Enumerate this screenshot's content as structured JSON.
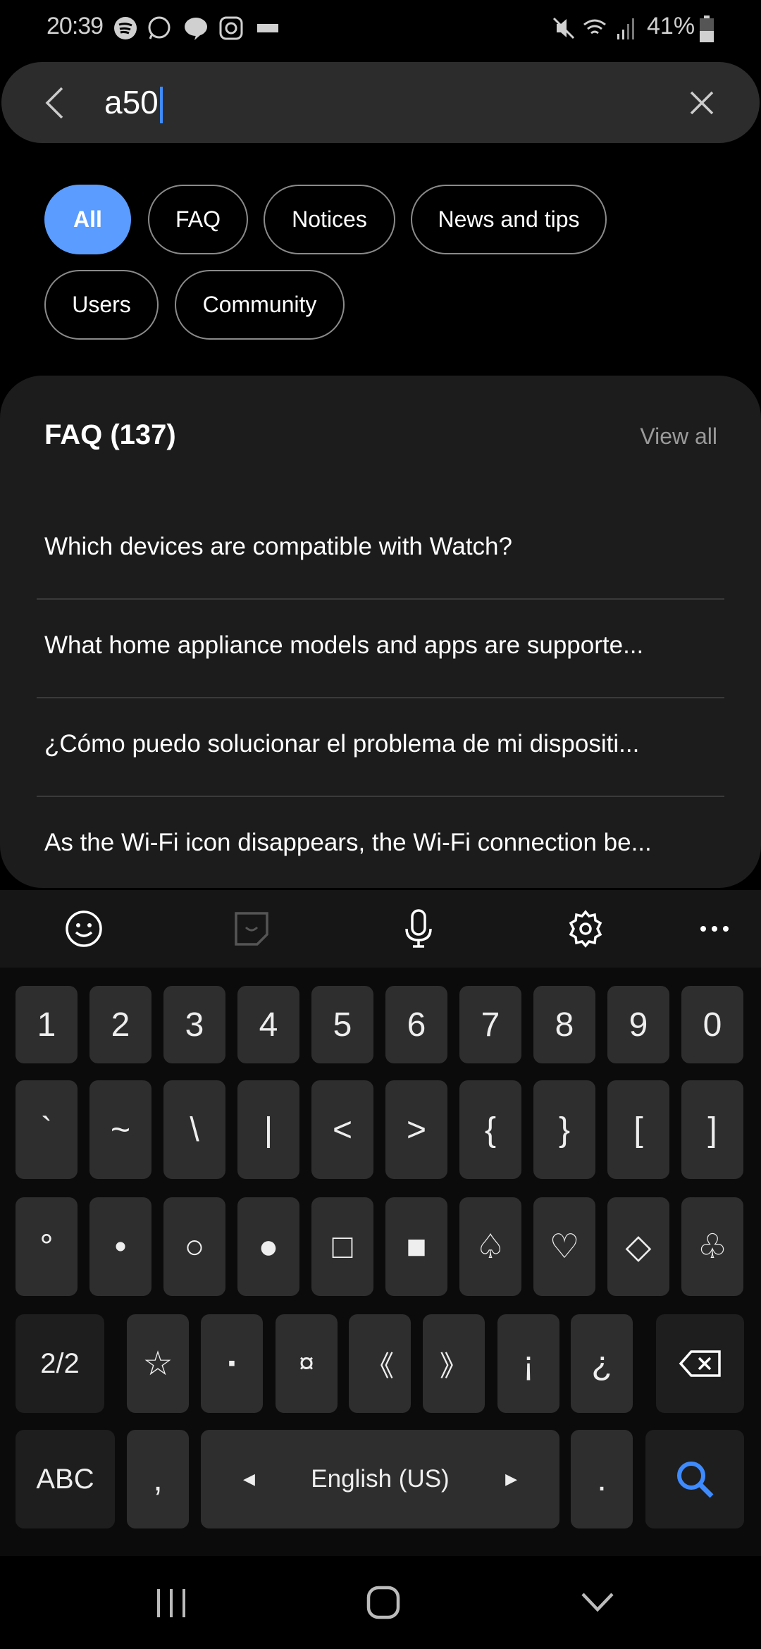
{
  "status_bar": {
    "time": "20:39",
    "battery": "41%",
    "notification_icons": [
      "spotify-icon",
      "whatsapp-icon",
      "line-icon",
      "instagram-icon",
      "keyboard-icon"
    ],
    "system_icons": [
      "mute-icon",
      "wifi-icon",
      "signal-icon",
      "battery-icon"
    ]
  },
  "search": {
    "query": "a50"
  },
  "filters": [
    {
      "label": "All",
      "active": true
    },
    {
      "label": "FAQ"
    },
    {
      "label": "Notices"
    },
    {
      "label": "News and tips"
    },
    {
      "label": "Users"
    },
    {
      "label": "Community"
    }
  ],
  "faq": {
    "title": "FAQ (137)",
    "view_all": "View all",
    "items": [
      "Which devices are compatible with Watch?",
      "What home appliance models and apps are supporte...",
      "¿Cómo puedo solucionar el problema de mi dispositi...",
      "As the Wi-Fi icon disappears, the Wi-Fi connection be..."
    ]
  },
  "keyboard": {
    "toolbar": [
      "emoji-icon",
      "sticker-icon",
      "microphone-icon",
      "settings-icon",
      "more-icon"
    ],
    "rows": [
      [
        "1",
        "2",
        "3",
        "4",
        "5",
        "6",
        "7",
        "8",
        "9",
        "0"
      ],
      [
        "`",
        "~",
        "\\",
        "|",
        "<",
        ">",
        "{",
        "}",
        "[",
        "]"
      ],
      [
        "°",
        "•",
        "○",
        "●",
        "□",
        "■",
        "♤",
        "♡",
        "◇",
        "♧"
      ]
    ],
    "row4": {
      "page": "2/2",
      "keys": [
        "☆",
        "▪",
        "¤",
        "《",
        "》",
        "¡",
        "¿"
      ]
    },
    "row5": {
      "abc": "ABC",
      "comma": ",",
      "space": "English (US)",
      "period": "."
    },
    "accent": "#3e8bff"
  }
}
